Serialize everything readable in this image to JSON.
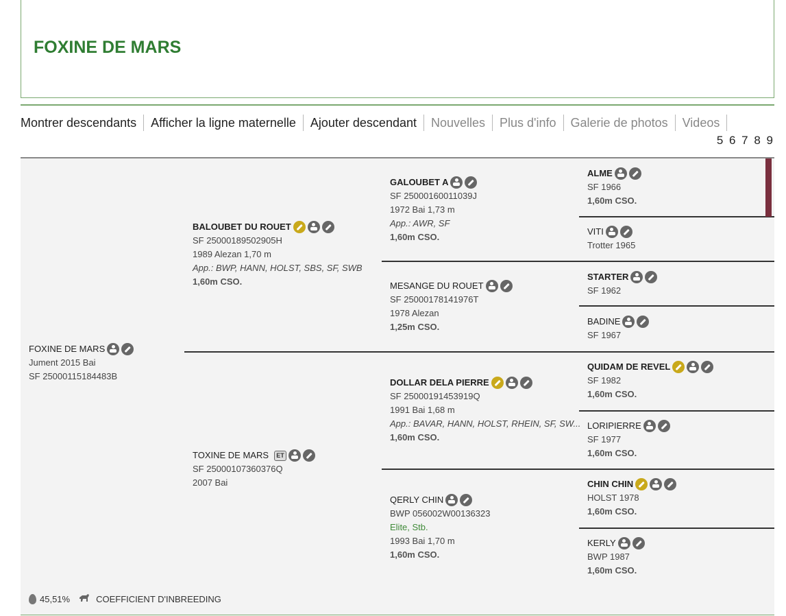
{
  "header": {
    "title": "FOXINE DE MARS"
  },
  "nav": {
    "items": [
      {
        "label": "Montrer descendants",
        "dim": false
      },
      {
        "label": "Afficher la ligne maternelle",
        "dim": false
      },
      {
        "label": "Ajouter descendant",
        "dim": false
      },
      {
        "label": "Nouvelles",
        "dim": true
      },
      {
        "label": "Plus d'info",
        "dim": true
      },
      {
        "label": "Galerie de photos",
        "dim": true
      },
      {
        "label": "Videos",
        "dim": true
      }
    ],
    "pagenums": "5 6 7 8 9"
  },
  "horses": {
    "subject": {
      "name": "FOXINE DE MARS",
      "l1": "Jument 2015 Bai",
      "l2": "SF 25000115184483B"
    },
    "sire": {
      "name": "BALOUBET DU ROUET",
      "l1": "SF 25000189502905H",
      "l2": "1989 Alezan 1,70 m",
      "app": "App.: BWP, HANN, HOLST, SBS, SF, SWB",
      "perf": "1,60m CSO."
    },
    "dam": {
      "name": "TOXINE DE MARS",
      "tag": "ET",
      "l1": "SF 25000107360376Q",
      "l2": "2007 Bai"
    },
    "ss": {
      "name": "GALOUBET A",
      "l1": "SF 25000160011039J",
      "l2": "1972 Bai 1,73 m",
      "app": "App.: AWR, SF",
      "perf": "1,60m CSO."
    },
    "sd": {
      "name": "MESANGE DU ROUET",
      "l1": "SF 25000178141976T",
      "l2": "1978 Alezan",
      "perf": "1,25m CSO."
    },
    "ds": {
      "name": "DOLLAR DELA PIERRE",
      "l1": "SF 25000191453919Q",
      "l2": "1991 Bai 1,68 m",
      "app": "App.: BAVAR, HANN, HOLST, RHEIN, SF, SW...",
      "perf": "1,60m CSO."
    },
    "dd": {
      "name": "QERLY CHIN",
      "l1": "BWP 056002W00136323",
      "award": "Elite, Stb.",
      "l2": "1993 Bai 1,70 m",
      "perf": "1,60m CSO."
    },
    "sss": {
      "name": "ALME",
      "l1": "SF 1966",
      "perf": "1,60m CSO."
    },
    "ssd": {
      "name": "VITI",
      "l1": "Trotter 1965"
    },
    "sds": {
      "name": "STARTER",
      "l1": "SF 1962"
    },
    "sdd": {
      "name": "BADINE",
      "l1": "SF 1967"
    },
    "dss": {
      "name": "QUIDAM DE REVEL",
      "l1": "SF 1982",
      "perf": "1,60m CSO."
    },
    "dsd": {
      "name": "LORIPIERRE",
      "l1": "SF 1977",
      "perf": "1,60m CSO."
    },
    "dds": {
      "name": "CHIN CHIN",
      "l1": "HOLST 1978",
      "perf": "1,60m CSO."
    },
    "ddd": {
      "name": "KERLY",
      "l1": "BWP 1987",
      "perf": "1,60m CSO."
    }
  },
  "footer": {
    "percent": "45,51%",
    "label": "COEFFICIENT D'INBREEDING"
  },
  "colors": {
    "accent": "#2f7d32",
    "gold_icon": "#c9a91b",
    "grey_icon": "#666666",
    "maroon_bar": "#7a2f3e"
  }
}
